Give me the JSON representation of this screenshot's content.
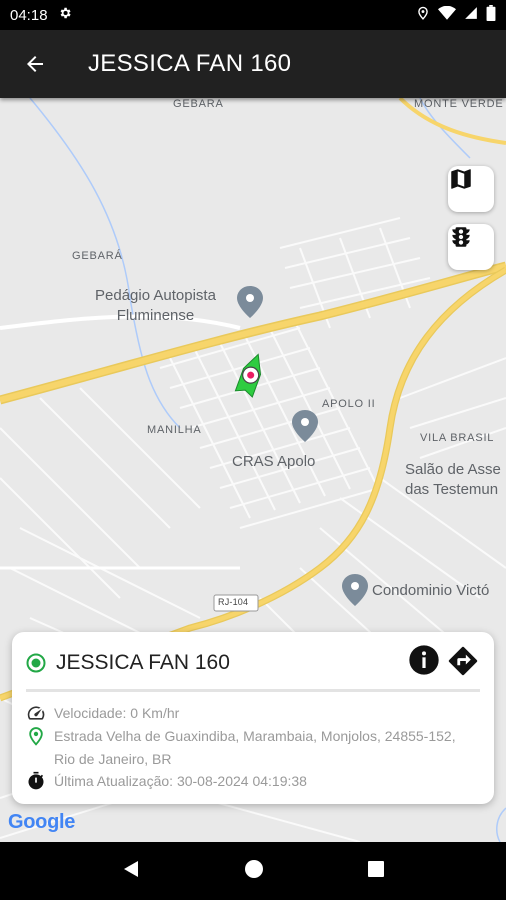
{
  "status": {
    "time": "04:18"
  },
  "app_bar": {
    "title": "JESSICA FAN 160"
  },
  "map": {
    "labels": {
      "gebara_top": "GEBARA",
      "monte_verde": "MONTE VERDE",
      "gebara": "GEBARÁ",
      "manilha": "MANILHA",
      "apolo": "APOLO II",
      "vila_brasil": "VILA BRASIL",
      "road": "RJ-104"
    },
    "pois": {
      "pedagio": "Pedágio Autopista\nFluminense",
      "cras": "CRAS Apolo",
      "salao": "Salão de Asse\ndas Testemun",
      "condominio": "Condominio Victó"
    }
  },
  "card": {
    "name": "JESSICA FAN 160",
    "speed": "Velocidade: 0 Km/hr",
    "address": "Estrada Velha de Guaxindiba, Marambaia, Monjolos, 24855-152, Rio de Janeiro, BR",
    "updated": "Última Atualização: 30-08-2024 04:19:38"
  },
  "google": "Google",
  "colors": {
    "online": "#22a846",
    "road_major": "#f7d56b",
    "app_bar": "#212121"
  }
}
